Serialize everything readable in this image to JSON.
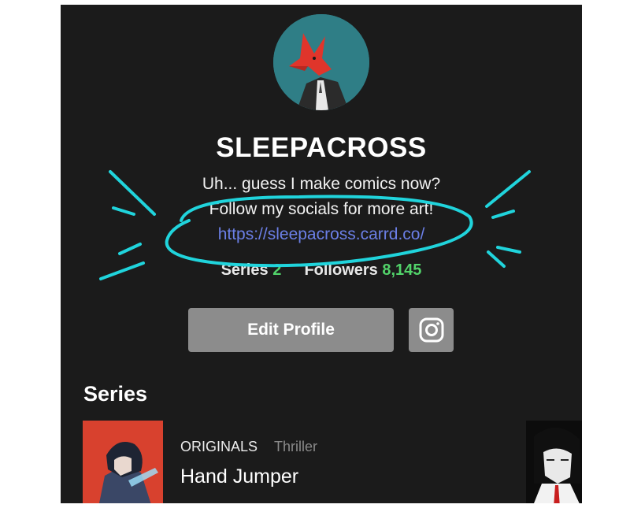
{
  "profile": {
    "username": "SLEEPACROSS",
    "bio_line1": "Uh... guess I make comics now?",
    "bio_line2": "Follow my socials for more art!",
    "link": "https://sleepacross.carrd.co/",
    "stats": {
      "series_label": "Series",
      "series_count": "2",
      "followers_label": "Followers",
      "followers_count": "8,145"
    }
  },
  "actions": {
    "edit_profile_label": "Edit Profile",
    "instagram_icon": "instagram-icon"
  },
  "series_section": {
    "title": "Series",
    "items": [
      {
        "tag": "ORIGINALS",
        "genre": "Thriller",
        "title": "Hand Jumper"
      }
    ]
  },
  "colors": {
    "background": "#1b1b1b",
    "accent_green": "#52d36a",
    "link_blue": "#6b7fe6",
    "button_gray": "#8c8c8c",
    "annotation_cyan": "#20d4dc"
  }
}
